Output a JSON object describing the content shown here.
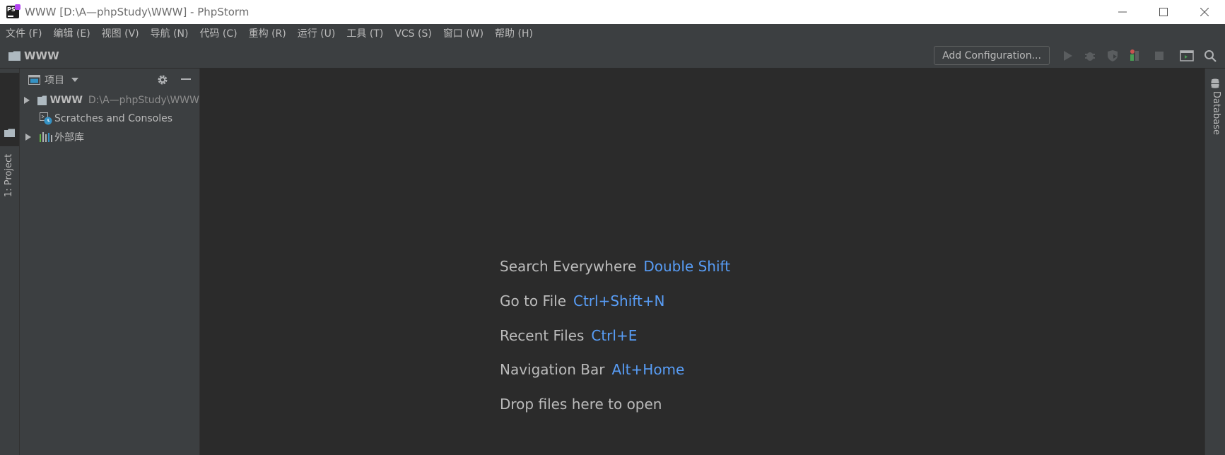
{
  "window": {
    "title": "WWW [D:\\A—phpStudy\\WWW] - PhpStorm",
    "logo_text": "PS"
  },
  "menu": [
    "文件 (F)",
    "编辑 (E)",
    "视图 (V)",
    "导航 (N)",
    "代码 (C)",
    "重构 (R)",
    "运行 (U)",
    "工具 (T)",
    "VCS (S)",
    "窗口 (W)",
    "帮助 (H)"
  ],
  "navbar": {
    "project_label": "WWW",
    "add_configuration": "Add Configuration..."
  },
  "left_stripe": {
    "project_tab": "1: Project"
  },
  "project_panel": {
    "title": "项目",
    "tree": [
      {
        "name": "WWW",
        "path": "D:\\A—phpStudy\\WWW",
        "expandable": true
      },
      {
        "name": "Scratches and Consoles",
        "expandable": false
      },
      {
        "name": "外部库",
        "expandable": true
      }
    ]
  },
  "editor_hints": [
    {
      "label": "Search Everywhere",
      "key": "Double Shift"
    },
    {
      "label": "Go to File",
      "key": "Ctrl+Shift+N"
    },
    {
      "label": "Recent Files",
      "key": "Ctrl+E"
    },
    {
      "label": "Navigation Bar",
      "key": "Alt+Home"
    },
    {
      "label": "Drop files here to open",
      "key": ""
    }
  ],
  "right_stripe": {
    "database_tab": "Database"
  },
  "colors": {
    "background": "#2b2b2b",
    "panel": "#3c3f41",
    "text": "#bbbbbb",
    "shortcut": "#589df6",
    "logo_accent": "#b345f1"
  },
  "icons": {
    "toolbar": [
      "run-icon",
      "debug-icon",
      "coverage-icon",
      "profile-icon",
      "stop-icon",
      "terminal-icon",
      "search-icon"
    ]
  }
}
